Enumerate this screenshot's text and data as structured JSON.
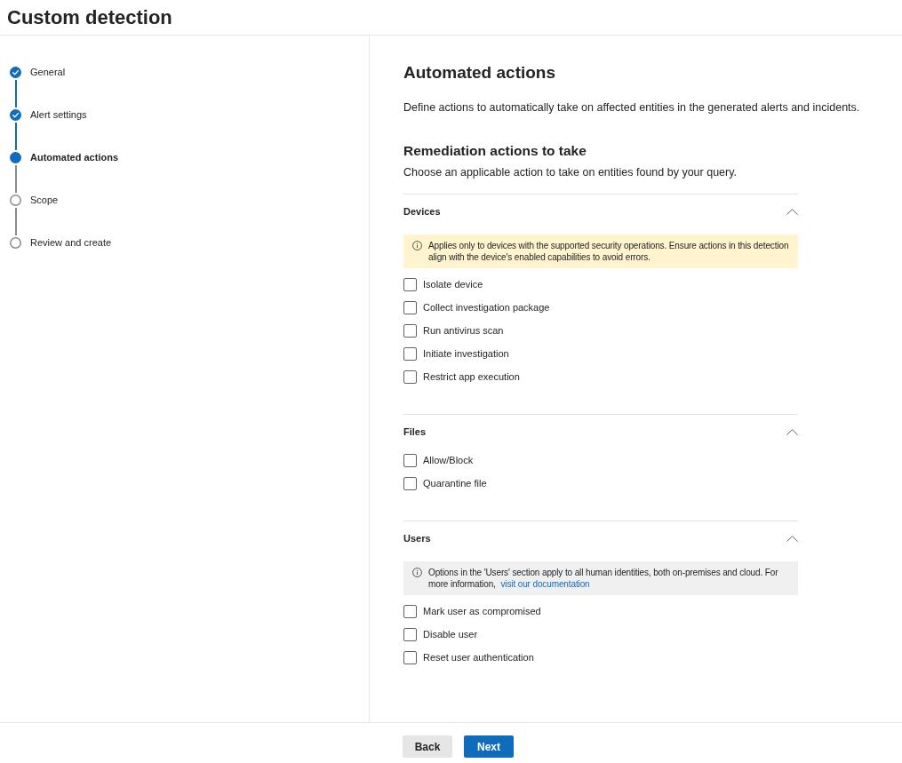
{
  "page": {
    "title": "Custom detection"
  },
  "steps": [
    {
      "label": "General",
      "completed": true,
      "selected": false
    },
    {
      "label": "Alert settings",
      "completed": true,
      "selected": false
    },
    {
      "label": "Automated actions",
      "completed": false,
      "selected": true
    },
    {
      "label": "Scope",
      "completed": false,
      "selected": false
    },
    {
      "label": "Review and create",
      "completed": false,
      "selected": false
    }
  ],
  "content": {
    "title": "Automated actions",
    "description": "Define actions to automatically take on affected entities in the generated alerts and incidents.",
    "subtitle": "Remediation actions to take",
    "subtitle_description": "Choose an applicable action to take on entities found by your query."
  },
  "sections": [
    {
      "title": "Devices",
      "expanded": true,
      "notice": {
        "kind": "warning",
        "text": "Applies only to devices with the supported security operations. Ensure actions in this detection align with the device's enabled capabilities to avoid errors."
      },
      "actions": [
        {
          "label": "Isolate device",
          "checked": false
        },
        {
          "label": "Collect investigation package",
          "checked": false
        },
        {
          "label": "Run antivirus scan",
          "checked": false
        },
        {
          "label": "Initiate investigation",
          "checked": false
        },
        {
          "label": "Restrict app execution",
          "checked": false
        }
      ]
    },
    {
      "title": "Files",
      "expanded": true,
      "actions": [
        {
          "label": "Allow/Block",
          "checked": false
        },
        {
          "label": "Quarantine file",
          "checked": false
        }
      ]
    },
    {
      "title": "Users",
      "expanded": true,
      "notice": {
        "kind": "info",
        "text": "Options in the 'Users' section apply to all human identities, both on-premises and cloud. For more information,",
        "link": "visit our documentation"
      },
      "actions": [
        {
          "label": "Mark user as compromised",
          "checked": false
        },
        {
          "label": "Disable user",
          "checked": false
        },
        {
          "label": "Reset user authentication",
          "checked": false
        }
      ]
    }
  ],
  "footer": {
    "buttons": [
      {
        "label": "Back",
        "kind": "secondary"
      },
      {
        "label": "Next",
        "kind": "primary"
      }
    ]
  }
}
